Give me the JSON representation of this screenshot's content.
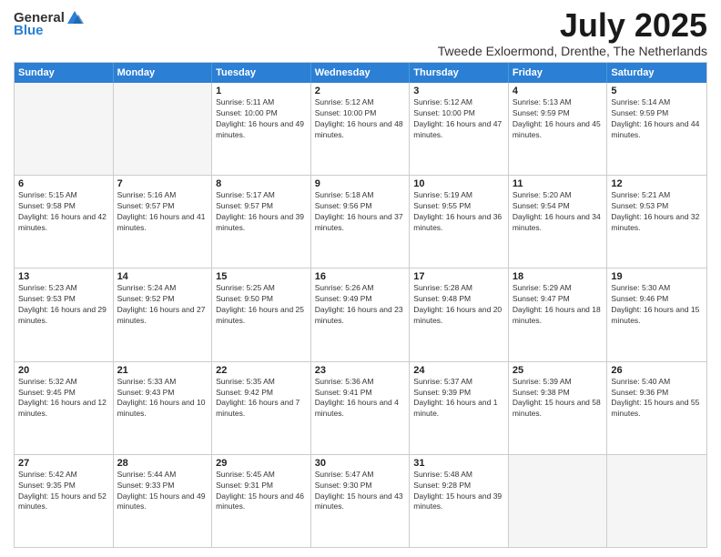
{
  "logo": {
    "text_general": "General",
    "text_blue": "Blue"
  },
  "title": "July 2025",
  "location": "Tweede Exloermond, Drenthe, The Netherlands",
  "header_days": [
    "Sunday",
    "Monday",
    "Tuesday",
    "Wednesday",
    "Thursday",
    "Friday",
    "Saturday"
  ],
  "weeks": [
    [
      {
        "day": "",
        "sunrise": "",
        "sunset": "",
        "daylight": "",
        "empty": true
      },
      {
        "day": "",
        "sunrise": "",
        "sunset": "",
        "daylight": "",
        "empty": true
      },
      {
        "day": "1",
        "sunrise": "Sunrise: 5:11 AM",
        "sunset": "Sunset: 10:00 PM",
        "daylight": "Daylight: 16 hours and 49 minutes."
      },
      {
        "day": "2",
        "sunrise": "Sunrise: 5:12 AM",
        "sunset": "Sunset: 10:00 PM",
        "daylight": "Daylight: 16 hours and 48 minutes."
      },
      {
        "day": "3",
        "sunrise": "Sunrise: 5:12 AM",
        "sunset": "Sunset: 10:00 PM",
        "daylight": "Daylight: 16 hours and 47 minutes."
      },
      {
        "day": "4",
        "sunrise": "Sunrise: 5:13 AM",
        "sunset": "Sunset: 9:59 PM",
        "daylight": "Daylight: 16 hours and 45 minutes."
      },
      {
        "day": "5",
        "sunrise": "Sunrise: 5:14 AM",
        "sunset": "Sunset: 9:59 PM",
        "daylight": "Daylight: 16 hours and 44 minutes."
      }
    ],
    [
      {
        "day": "6",
        "sunrise": "Sunrise: 5:15 AM",
        "sunset": "Sunset: 9:58 PM",
        "daylight": "Daylight: 16 hours and 42 minutes."
      },
      {
        "day": "7",
        "sunrise": "Sunrise: 5:16 AM",
        "sunset": "Sunset: 9:57 PM",
        "daylight": "Daylight: 16 hours and 41 minutes."
      },
      {
        "day": "8",
        "sunrise": "Sunrise: 5:17 AM",
        "sunset": "Sunset: 9:57 PM",
        "daylight": "Daylight: 16 hours and 39 minutes."
      },
      {
        "day": "9",
        "sunrise": "Sunrise: 5:18 AM",
        "sunset": "Sunset: 9:56 PM",
        "daylight": "Daylight: 16 hours and 37 minutes."
      },
      {
        "day": "10",
        "sunrise": "Sunrise: 5:19 AM",
        "sunset": "Sunset: 9:55 PM",
        "daylight": "Daylight: 16 hours and 36 minutes."
      },
      {
        "day": "11",
        "sunrise": "Sunrise: 5:20 AM",
        "sunset": "Sunset: 9:54 PM",
        "daylight": "Daylight: 16 hours and 34 minutes."
      },
      {
        "day": "12",
        "sunrise": "Sunrise: 5:21 AM",
        "sunset": "Sunset: 9:53 PM",
        "daylight": "Daylight: 16 hours and 32 minutes."
      }
    ],
    [
      {
        "day": "13",
        "sunrise": "Sunrise: 5:23 AM",
        "sunset": "Sunset: 9:53 PM",
        "daylight": "Daylight: 16 hours and 29 minutes."
      },
      {
        "day": "14",
        "sunrise": "Sunrise: 5:24 AM",
        "sunset": "Sunset: 9:52 PM",
        "daylight": "Daylight: 16 hours and 27 minutes."
      },
      {
        "day": "15",
        "sunrise": "Sunrise: 5:25 AM",
        "sunset": "Sunset: 9:50 PM",
        "daylight": "Daylight: 16 hours and 25 minutes."
      },
      {
        "day": "16",
        "sunrise": "Sunrise: 5:26 AM",
        "sunset": "Sunset: 9:49 PM",
        "daylight": "Daylight: 16 hours and 23 minutes."
      },
      {
        "day": "17",
        "sunrise": "Sunrise: 5:28 AM",
        "sunset": "Sunset: 9:48 PM",
        "daylight": "Daylight: 16 hours and 20 minutes."
      },
      {
        "day": "18",
        "sunrise": "Sunrise: 5:29 AM",
        "sunset": "Sunset: 9:47 PM",
        "daylight": "Daylight: 16 hours and 18 minutes."
      },
      {
        "day": "19",
        "sunrise": "Sunrise: 5:30 AM",
        "sunset": "Sunset: 9:46 PM",
        "daylight": "Daylight: 16 hours and 15 minutes."
      }
    ],
    [
      {
        "day": "20",
        "sunrise": "Sunrise: 5:32 AM",
        "sunset": "Sunset: 9:45 PM",
        "daylight": "Daylight: 16 hours and 12 minutes."
      },
      {
        "day": "21",
        "sunrise": "Sunrise: 5:33 AM",
        "sunset": "Sunset: 9:43 PM",
        "daylight": "Daylight: 16 hours and 10 minutes."
      },
      {
        "day": "22",
        "sunrise": "Sunrise: 5:35 AM",
        "sunset": "Sunset: 9:42 PM",
        "daylight": "Daylight: 16 hours and 7 minutes."
      },
      {
        "day": "23",
        "sunrise": "Sunrise: 5:36 AM",
        "sunset": "Sunset: 9:41 PM",
        "daylight": "Daylight: 16 hours and 4 minutes."
      },
      {
        "day": "24",
        "sunrise": "Sunrise: 5:37 AM",
        "sunset": "Sunset: 9:39 PM",
        "daylight": "Daylight: 16 hours and 1 minute."
      },
      {
        "day": "25",
        "sunrise": "Sunrise: 5:39 AM",
        "sunset": "Sunset: 9:38 PM",
        "daylight": "Daylight: 15 hours and 58 minutes."
      },
      {
        "day": "26",
        "sunrise": "Sunrise: 5:40 AM",
        "sunset": "Sunset: 9:36 PM",
        "daylight": "Daylight: 15 hours and 55 minutes."
      }
    ],
    [
      {
        "day": "27",
        "sunrise": "Sunrise: 5:42 AM",
        "sunset": "Sunset: 9:35 PM",
        "daylight": "Daylight: 15 hours and 52 minutes."
      },
      {
        "day": "28",
        "sunrise": "Sunrise: 5:44 AM",
        "sunset": "Sunset: 9:33 PM",
        "daylight": "Daylight: 15 hours and 49 minutes."
      },
      {
        "day": "29",
        "sunrise": "Sunrise: 5:45 AM",
        "sunset": "Sunset: 9:31 PM",
        "daylight": "Daylight: 15 hours and 46 minutes."
      },
      {
        "day": "30",
        "sunrise": "Sunrise: 5:47 AM",
        "sunset": "Sunset: 9:30 PM",
        "daylight": "Daylight: 15 hours and 43 minutes."
      },
      {
        "day": "31",
        "sunrise": "Sunrise: 5:48 AM",
        "sunset": "Sunset: 9:28 PM",
        "daylight": "Daylight: 15 hours and 39 minutes."
      },
      {
        "day": "",
        "sunrise": "",
        "sunset": "",
        "daylight": "",
        "empty": true
      },
      {
        "day": "",
        "sunrise": "",
        "sunset": "",
        "daylight": "",
        "empty": true
      }
    ]
  ]
}
